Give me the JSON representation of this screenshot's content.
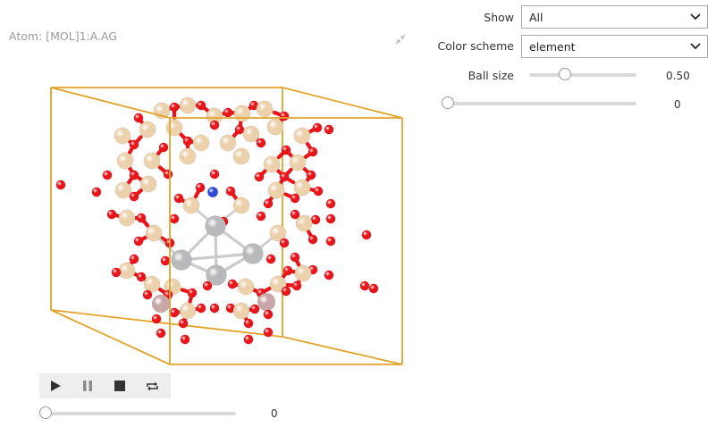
{
  "viewer": {
    "atom_label": "Atom: [MOL]1:A.AG",
    "frame_value": "0",
    "frame_fraction": 0.0
  },
  "player": {
    "buttons": [
      "play-icon",
      "pause-icon",
      "stop-icon",
      "repeat-icon"
    ]
  },
  "controls": {
    "show_label": "Show",
    "show_value": "All",
    "color_scheme_label": "Color scheme",
    "color_scheme_value": "element",
    "ball_size_label": "Ball size",
    "ball_size_value": "0.50",
    "ball_size_fraction": 0.35,
    "slider2_value": "0",
    "slider2_fraction": 0.0
  },
  "colors": {
    "cell_edge": "#e2a32a",
    "oxygen": "#e8151a",
    "silicon": "#ecd1ad",
    "silver": "#b7b9bb",
    "nitrogen": "#2e4bd8",
    "aluminium": "#c7a7a7"
  }
}
